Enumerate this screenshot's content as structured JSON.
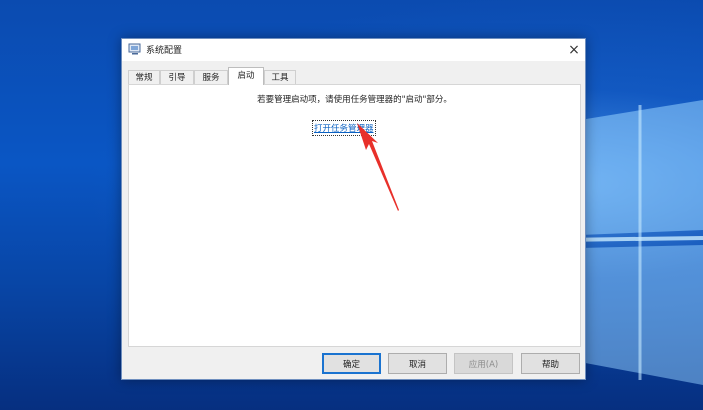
{
  "dialog": {
    "title": "系统配置",
    "close_glyph": "×"
  },
  "tabs": [
    {
      "label": "常规"
    },
    {
      "label": "引导"
    },
    {
      "label": "服务"
    },
    {
      "label": "启动"
    },
    {
      "label": "工具"
    }
  ],
  "active_tab": "启动",
  "startup": {
    "info_text": "若要管理启动项，请使用任务管理器的\"启动\"部分。",
    "link_text": "打开任务管理器"
  },
  "buttons": {
    "ok": "确定",
    "cancel": "取消",
    "apply": "应用(A)",
    "help": "帮助"
  },
  "colors": {
    "link": "#0b61c2",
    "annotation_arrow": "#e8302a",
    "default_button_border": "#1a73d0"
  },
  "icons": {
    "title": "system-config-icon",
    "close": "close-icon",
    "arrow": "red-annotation-arrow"
  }
}
